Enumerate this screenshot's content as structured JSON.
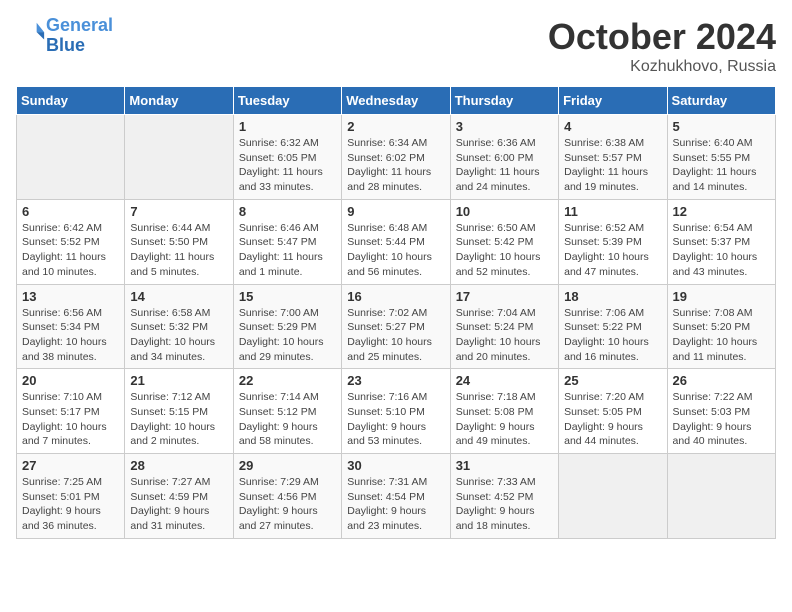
{
  "header": {
    "logo_line1": "General",
    "logo_line2": "Blue",
    "month_title": "October 2024",
    "location": "Kozhukhovo, Russia"
  },
  "days_of_week": [
    "Sunday",
    "Monday",
    "Tuesday",
    "Wednesday",
    "Thursday",
    "Friday",
    "Saturday"
  ],
  "weeks": [
    [
      {
        "day": "",
        "info": ""
      },
      {
        "day": "",
        "info": ""
      },
      {
        "day": "1",
        "info": "Sunrise: 6:32 AM\nSunset: 6:05 PM\nDaylight: 11 hours and 33 minutes."
      },
      {
        "day": "2",
        "info": "Sunrise: 6:34 AM\nSunset: 6:02 PM\nDaylight: 11 hours and 28 minutes."
      },
      {
        "day": "3",
        "info": "Sunrise: 6:36 AM\nSunset: 6:00 PM\nDaylight: 11 hours and 24 minutes."
      },
      {
        "day": "4",
        "info": "Sunrise: 6:38 AM\nSunset: 5:57 PM\nDaylight: 11 hours and 19 minutes."
      },
      {
        "day": "5",
        "info": "Sunrise: 6:40 AM\nSunset: 5:55 PM\nDaylight: 11 hours and 14 minutes."
      }
    ],
    [
      {
        "day": "6",
        "info": "Sunrise: 6:42 AM\nSunset: 5:52 PM\nDaylight: 11 hours and 10 minutes."
      },
      {
        "day": "7",
        "info": "Sunrise: 6:44 AM\nSunset: 5:50 PM\nDaylight: 11 hours and 5 minutes."
      },
      {
        "day": "8",
        "info": "Sunrise: 6:46 AM\nSunset: 5:47 PM\nDaylight: 11 hours and 1 minute."
      },
      {
        "day": "9",
        "info": "Sunrise: 6:48 AM\nSunset: 5:44 PM\nDaylight: 10 hours and 56 minutes."
      },
      {
        "day": "10",
        "info": "Sunrise: 6:50 AM\nSunset: 5:42 PM\nDaylight: 10 hours and 52 minutes."
      },
      {
        "day": "11",
        "info": "Sunrise: 6:52 AM\nSunset: 5:39 PM\nDaylight: 10 hours and 47 minutes."
      },
      {
        "day": "12",
        "info": "Sunrise: 6:54 AM\nSunset: 5:37 PM\nDaylight: 10 hours and 43 minutes."
      }
    ],
    [
      {
        "day": "13",
        "info": "Sunrise: 6:56 AM\nSunset: 5:34 PM\nDaylight: 10 hours and 38 minutes."
      },
      {
        "day": "14",
        "info": "Sunrise: 6:58 AM\nSunset: 5:32 PM\nDaylight: 10 hours and 34 minutes."
      },
      {
        "day": "15",
        "info": "Sunrise: 7:00 AM\nSunset: 5:29 PM\nDaylight: 10 hours and 29 minutes."
      },
      {
        "day": "16",
        "info": "Sunrise: 7:02 AM\nSunset: 5:27 PM\nDaylight: 10 hours and 25 minutes."
      },
      {
        "day": "17",
        "info": "Sunrise: 7:04 AM\nSunset: 5:24 PM\nDaylight: 10 hours and 20 minutes."
      },
      {
        "day": "18",
        "info": "Sunrise: 7:06 AM\nSunset: 5:22 PM\nDaylight: 10 hours and 16 minutes."
      },
      {
        "day": "19",
        "info": "Sunrise: 7:08 AM\nSunset: 5:20 PM\nDaylight: 10 hours and 11 minutes."
      }
    ],
    [
      {
        "day": "20",
        "info": "Sunrise: 7:10 AM\nSunset: 5:17 PM\nDaylight: 10 hours and 7 minutes."
      },
      {
        "day": "21",
        "info": "Sunrise: 7:12 AM\nSunset: 5:15 PM\nDaylight: 10 hours and 2 minutes."
      },
      {
        "day": "22",
        "info": "Sunrise: 7:14 AM\nSunset: 5:12 PM\nDaylight: 9 hours and 58 minutes."
      },
      {
        "day": "23",
        "info": "Sunrise: 7:16 AM\nSunset: 5:10 PM\nDaylight: 9 hours and 53 minutes."
      },
      {
        "day": "24",
        "info": "Sunrise: 7:18 AM\nSunset: 5:08 PM\nDaylight: 9 hours and 49 minutes."
      },
      {
        "day": "25",
        "info": "Sunrise: 7:20 AM\nSunset: 5:05 PM\nDaylight: 9 hours and 44 minutes."
      },
      {
        "day": "26",
        "info": "Sunrise: 7:22 AM\nSunset: 5:03 PM\nDaylight: 9 hours and 40 minutes."
      }
    ],
    [
      {
        "day": "27",
        "info": "Sunrise: 7:25 AM\nSunset: 5:01 PM\nDaylight: 9 hours and 36 minutes."
      },
      {
        "day": "28",
        "info": "Sunrise: 7:27 AM\nSunset: 4:59 PM\nDaylight: 9 hours and 31 minutes."
      },
      {
        "day": "29",
        "info": "Sunrise: 7:29 AM\nSunset: 4:56 PM\nDaylight: 9 hours and 27 minutes."
      },
      {
        "day": "30",
        "info": "Sunrise: 7:31 AM\nSunset: 4:54 PM\nDaylight: 9 hours and 23 minutes."
      },
      {
        "day": "31",
        "info": "Sunrise: 7:33 AM\nSunset: 4:52 PM\nDaylight: 9 hours and 18 minutes."
      },
      {
        "day": "",
        "info": ""
      },
      {
        "day": "",
        "info": ""
      }
    ]
  ]
}
